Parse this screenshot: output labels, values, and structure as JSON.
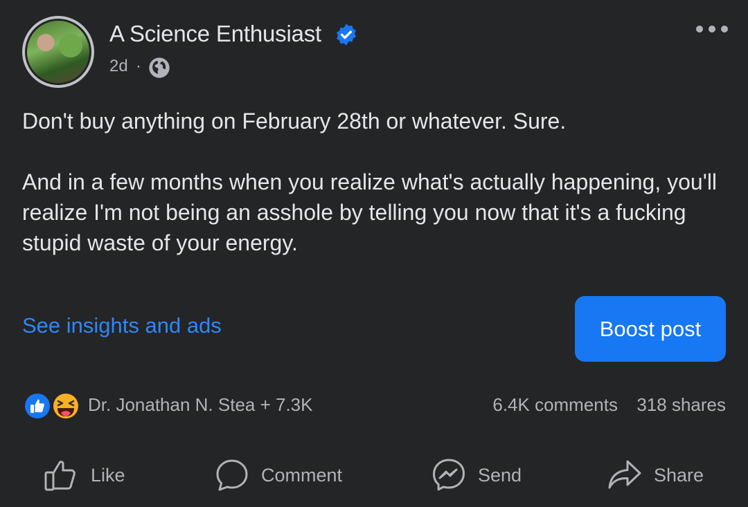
{
  "post": {
    "author": "A Science Enthusiast",
    "timestamp": "2d",
    "separator": "·",
    "audience_icon": "globe-icon",
    "text": "Don't buy anything on February 28th or whatever. Sure.\n\nAnd in a few months when you realize what's actually happening, you'll realize I'm not being an asshole by telling you now that it's a fucking stupid waste of your energy."
  },
  "links": {
    "insights": "See insights and ads"
  },
  "buttons": {
    "boost": "Boost post"
  },
  "engagement": {
    "reaction_icons": [
      "like-reaction-icon",
      "haha-reaction-icon"
    ],
    "reactors": "Dr. Jonathan N. Stea + 7.3K",
    "comments": "6.4K comments",
    "shares": "318 shares"
  },
  "actions": {
    "like": "Like",
    "comment": "Comment",
    "send": "Send",
    "share": "Share"
  },
  "colors": {
    "background": "#242526",
    "accent": "#1877f2",
    "link": "#2d88ff",
    "text": "#e4e6eb",
    "secondary": "#b0b3b8"
  }
}
